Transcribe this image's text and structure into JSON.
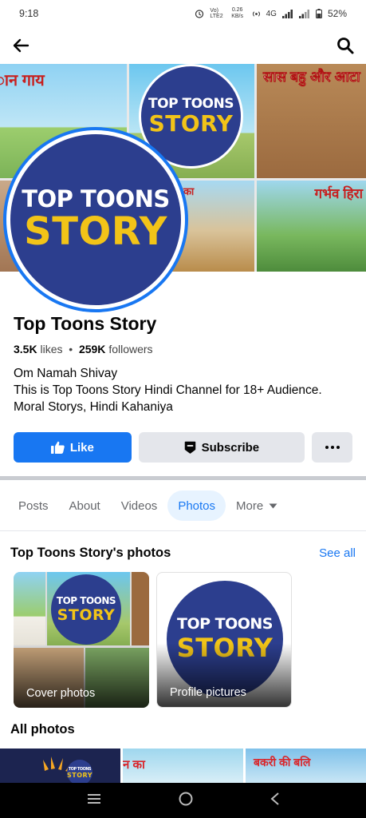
{
  "status_bar": {
    "time": "9:18",
    "network_speed": "0.26 KB/s",
    "network_type": "4G",
    "battery": "52%"
  },
  "nav": {
    "back_icon": "arrow-left-icon",
    "search_icon": "search-icon"
  },
  "cover": {
    "tiles": [
      "ान गाय",
      "सास बहु और आटा",
      "बहु का",
      "गर्भव हिरा"
    ],
    "logo_line1": "TOP TOONS",
    "logo_line2": "STORY"
  },
  "profile": {
    "name": "Top Toons Story",
    "likes_count": "3.5K",
    "likes_label": "likes",
    "followers_count": "259K",
    "followers_label": "followers",
    "bio_line1": "Om Namah Shivay",
    "bio_line2": "This is Top Toons Story Hindi Channel for 18+ Audience. Moral Storys, Hindi Kahaniya"
  },
  "actions": {
    "like_label": "Like",
    "subscribe_label": "Subscribe"
  },
  "tabs": [
    {
      "label": "Posts",
      "active": false
    },
    {
      "label": "About",
      "active": false
    },
    {
      "label": "Videos",
      "active": false
    },
    {
      "label": "Photos",
      "active": true
    },
    {
      "label": "More",
      "active": false
    }
  ],
  "photos_section": {
    "title": "Top Toons Story's photos",
    "see_all": "See all",
    "albums": [
      {
        "label": "Cover photos"
      },
      {
        "label": "Profile pictures"
      }
    ],
    "all_photos_title": "All photos",
    "strip_captions": [
      "न का",
      "बकरी की बलि"
    ]
  },
  "colors": {
    "accent": "#1877f2",
    "logo_blue": "#2c3e8e",
    "logo_yellow": "#f2c418"
  }
}
